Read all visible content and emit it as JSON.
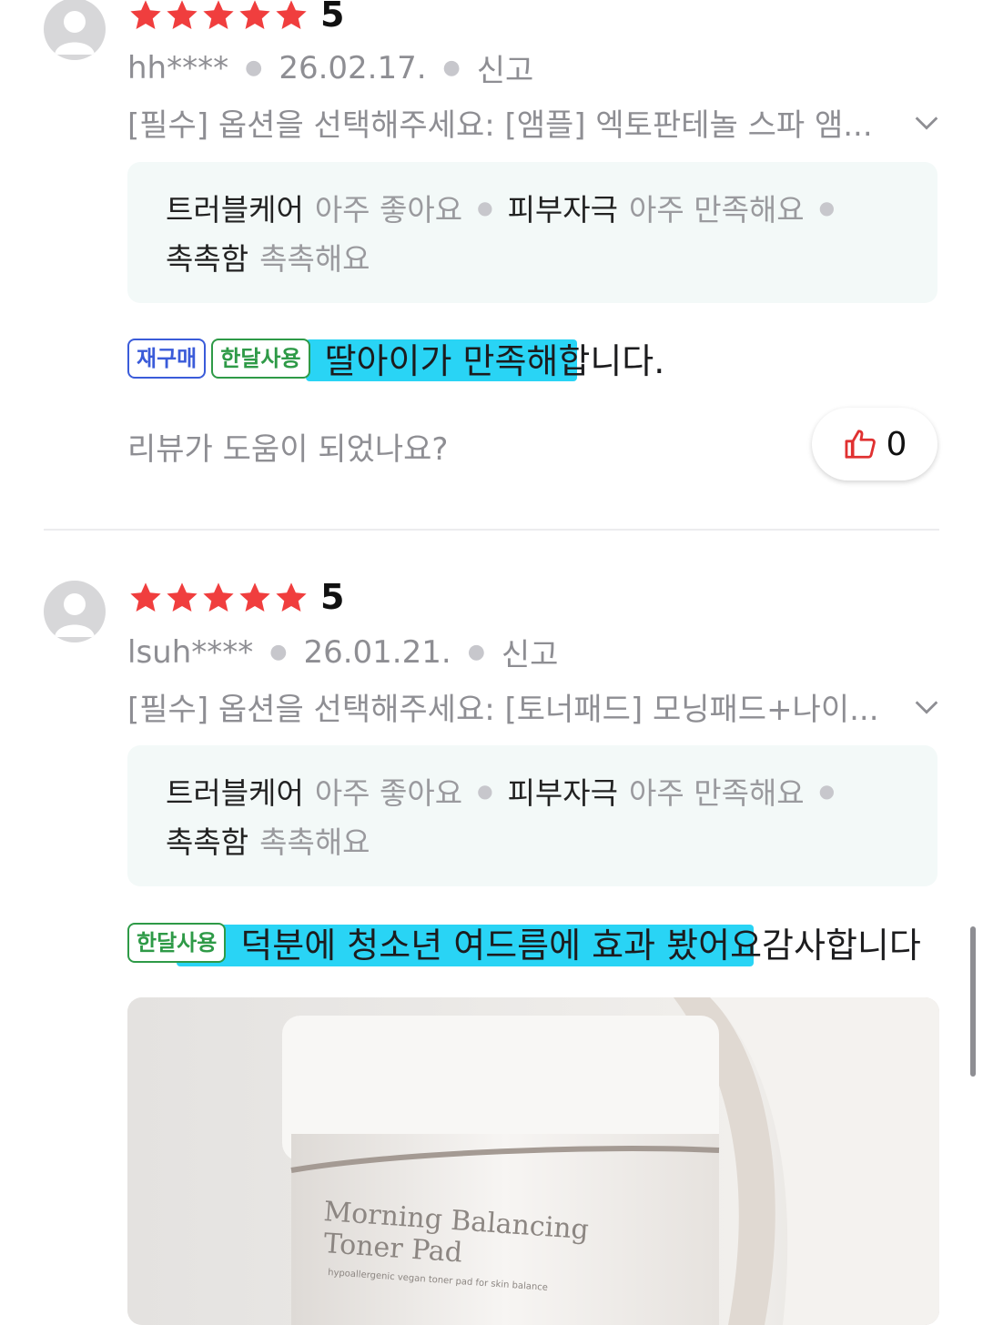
{
  "reviews": [
    {
      "rating": "5",
      "user": "hh****",
      "date": "26.02.17.",
      "report": "신고",
      "option": "[필수] 옵션을 선택해주세요: [앰플] 엑토판테놀 스파 앰...",
      "evals": [
        {
          "key": "트러블케어",
          "value": "아주 좋아요"
        },
        {
          "key": "피부자극",
          "value": "아주 만족해요"
        },
        {
          "key": "촉촉함",
          "value": "촉촉해요"
        }
      ],
      "badges": [
        "재구매",
        "한달사용"
      ],
      "text_highlight": "딸아이가 만족해합",
      "text_rest": "니다.",
      "helpful_question": "리뷰가 도움이 되었나요?",
      "likes": "0"
    },
    {
      "rating": "5",
      "user": "lsuh****",
      "date": "26.01.21.",
      "report": "신고",
      "option": "[필수] 옵션을 선택해주세요: [토너패드] 모닝패드+나이...",
      "evals": [
        {
          "key": "트러블케어",
          "value": "아주 좋아요"
        },
        {
          "key": "피부자극",
          "value": "아주 만족해요"
        },
        {
          "key": "촉촉함",
          "value": "촉촉해요"
        }
      ],
      "badges": [
        "한달사용"
      ],
      "text_highlight": "덕분에 청소년 여드름에 효과 봤어요",
      "text_rest": " 감사합니다",
      "photo": {
        "line1": "Morning Balancing",
        "line2": "Toner Pad",
        "line3": "hypoallergenic vegan toner pad for skin balance"
      }
    }
  ],
  "colors": {
    "star": "#f03e3e",
    "highlight": "#29d4f5",
    "eval_bg": "#f3f9f8",
    "badge_blue": "#3a5bd9",
    "badge_green": "#2e9a47",
    "like_icon": "#e03131"
  }
}
